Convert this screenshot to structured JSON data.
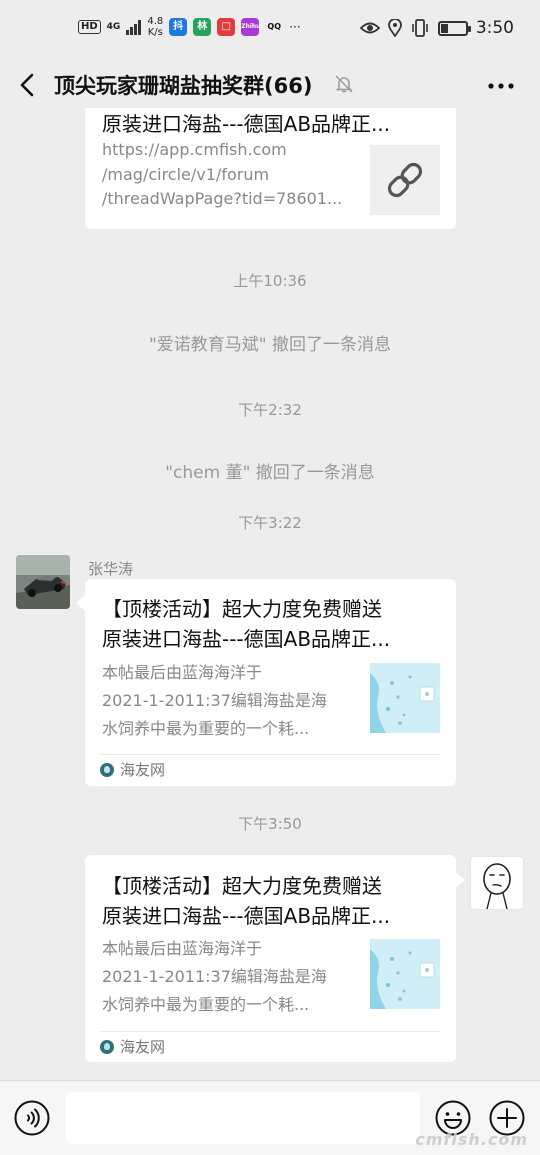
{
  "status_bar": {
    "hd_label": "HD",
    "network": "4G",
    "speed_value": "4.8",
    "speed_unit": "K/s",
    "app_badges": [
      "抖",
      "林",
      "□",
      "Zhihu",
      "QQ"
    ],
    "more": "···",
    "time": "3:50"
  },
  "header": {
    "title": "顶尖玩家珊瑚盐抽奖群(66)"
  },
  "messages": {
    "first_card": {
      "title": "原装进口海盐---德国AB品牌正...",
      "url_lines": [
        "https://app.cmfish.com",
        "/mag/circle/v1/forum",
        "/threadWapPage?tid=78601..."
      ],
      "thumb_icon": "link-icon"
    },
    "time_1": "上午10:36",
    "system_1": "\"爱诺教育马斌\" 撤回了一条消息",
    "time_2": "下午2:32",
    "system_2": "\"chem 董\" 撤回了一条消息",
    "time_3": "下午3:22",
    "sender_name": "张华涛",
    "second_card": {
      "title_line1": "【顶楼活动】超大力度免费赠送",
      "title_line2": "原装进口海盐---德国AB品牌正...",
      "desc": [
        "本帖最后由蓝海海洋于",
        "2021-1-2011:37编辑海盐是海",
        "水饲养中最为重要的一个耗..."
      ],
      "source": "海友网"
    },
    "time_4": "下午3:50",
    "third_card": {
      "title_line1": "【顶楼活动】超大力度免费赠送",
      "title_line2": "原装进口海盐---德国AB品牌正...",
      "desc": [
        "本帖最后由蓝海海洋于",
        "2021-1-2011:37编辑海盐是海",
        "水饲养中最为重要的一个耗..."
      ],
      "source": "海友网"
    }
  },
  "input_bar": {
    "value": "",
    "placeholder": ""
  },
  "watermark": "cmfish.com",
  "colors": {
    "background": "#ededed",
    "card": "#ffffff",
    "muted_text": "#999999",
    "source_icon": "#2d6f7a"
  }
}
